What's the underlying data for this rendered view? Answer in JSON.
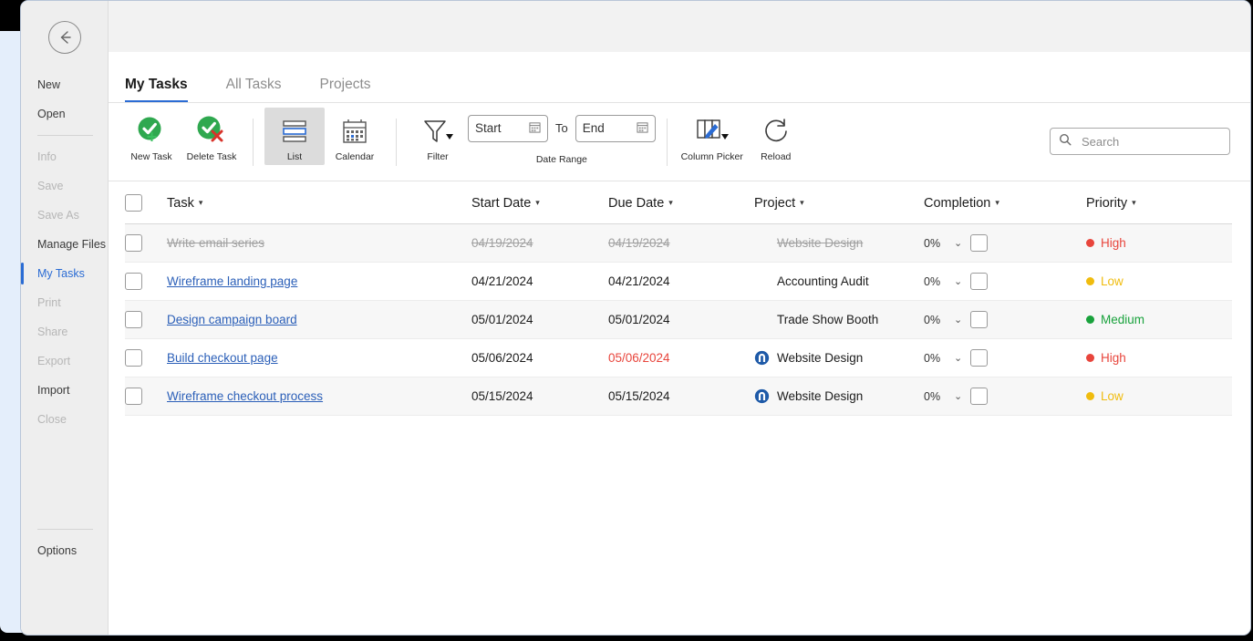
{
  "sidebar": {
    "back_icon": "back-arrow-icon",
    "items": [
      {
        "label": "New",
        "state": "normal"
      },
      {
        "label": "Open",
        "state": "normal"
      },
      {
        "label": "__SEP__",
        "state": "separator"
      },
      {
        "label": "Info",
        "state": "disabled"
      },
      {
        "label": "Save",
        "state": "disabled"
      },
      {
        "label": "Save As",
        "state": "disabled"
      },
      {
        "label": "Manage Files",
        "state": "normal"
      },
      {
        "label": "My Tasks",
        "state": "active"
      },
      {
        "label": "Print",
        "state": "disabled"
      },
      {
        "label": "Share",
        "state": "disabled"
      },
      {
        "label": "Export",
        "state": "disabled"
      },
      {
        "label": "Import",
        "state": "normal"
      },
      {
        "label": "Close",
        "state": "disabled"
      }
    ],
    "options_label": "Options"
  },
  "tabs": [
    {
      "label": "My Tasks",
      "active": true
    },
    {
      "label": "All Tasks",
      "active": false
    },
    {
      "label": "Projects",
      "active": false
    }
  ],
  "ribbon": {
    "new_task": {
      "label": "New Task",
      "icon": "green-check-plus-icon"
    },
    "delete_task": {
      "label": "Delete Task",
      "icon": "green-check-red-x-icon"
    },
    "list_view": {
      "label": "List",
      "icon": "list-view-icon",
      "selected": true
    },
    "calendar_view": {
      "label": "Calendar",
      "icon": "calendar-icon",
      "selected": false
    },
    "filter": {
      "label": "Filter",
      "icon": "funnel-icon"
    },
    "date_range": {
      "caption": "Date Range",
      "start_placeholder": "Start",
      "start_value": "",
      "to_label": "To",
      "end_placeholder": "End",
      "end_value": "",
      "calendar_icon": "calendar-picker-icon"
    },
    "column_picker": {
      "label": "Column Picker",
      "icon": "column-picker-pencil-icon"
    },
    "reload": {
      "label": "Reload",
      "icon": "refresh-circular-arrow-icon"
    }
  },
  "search": {
    "placeholder": "Search",
    "value": "",
    "icon": "search-icon"
  },
  "table": {
    "columns": [
      {
        "key": "select",
        "label": "",
        "sortable": false
      },
      {
        "key": "task",
        "label": "Task",
        "sortable": true
      },
      {
        "key": "start_date",
        "label": "Start Date",
        "sortable": true
      },
      {
        "key": "due_date",
        "label": "Due Date",
        "sortable": true
      },
      {
        "key": "project",
        "label": "Project",
        "sortable": true
      },
      {
        "key": "completion",
        "label": "Completion",
        "sortable": true
      },
      {
        "key": "priority",
        "label": "Priority",
        "sortable": true
      }
    ],
    "sort_caret": "▾",
    "rows": [
      {
        "task": "Write email series",
        "task_completed": true,
        "start_date": "04/19/2024",
        "due_date": "04/19/2024",
        "due_overdue": false,
        "project": "Website Design",
        "project_has_icon": false,
        "completion": "0%",
        "priority": "High",
        "priority_color": "#e8453c",
        "checked": false
      },
      {
        "task": "Wireframe landing page",
        "task_completed": false,
        "start_date": "04/21/2024",
        "due_date": "04/21/2024",
        "due_overdue": false,
        "project": "Accounting Audit",
        "project_has_icon": false,
        "completion": "0%",
        "priority": "Low",
        "priority_color": "#f0bc0e",
        "checked": false
      },
      {
        "task": "Design campaign board",
        "task_completed": false,
        "start_date": "05/01/2024",
        "due_date": "05/01/2024",
        "due_overdue": false,
        "project": "Trade Show Booth",
        "project_has_icon": false,
        "completion": "0%",
        "priority": "Medium",
        "priority_color": "#19a23c",
        "checked": false
      },
      {
        "task": "Build checkout page",
        "task_completed": false,
        "start_date": "05/06/2024",
        "due_date": "05/06/2024",
        "due_overdue": true,
        "project": "Website Design",
        "project_has_icon": true,
        "completion": "0%",
        "priority": "High",
        "priority_color": "#e8453c",
        "checked": false
      },
      {
        "task": "Wireframe checkout process",
        "task_completed": false,
        "start_date": "05/15/2024",
        "due_date": "05/15/2024",
        "due_overdue": false,
        "project": "Website Design",
        "project_has_icon": true,
        "completion": "0%",
        "priority": "Low",
        "priority_color": "#f0bc0e",
        "checked": false
      }
    ]
  },
  "colors": {
    "accent": "#2b6cd4",
    "link": "#2b5fb8",
    "overdue": "#e8453c",
    "high": "#e8453c",
    "medium": "#19a23c",
    "low": "#f0bc0e",
    "green_icon": "#2fa84f",
    "backdrop_blue": "#e4eefb"
  }
}
